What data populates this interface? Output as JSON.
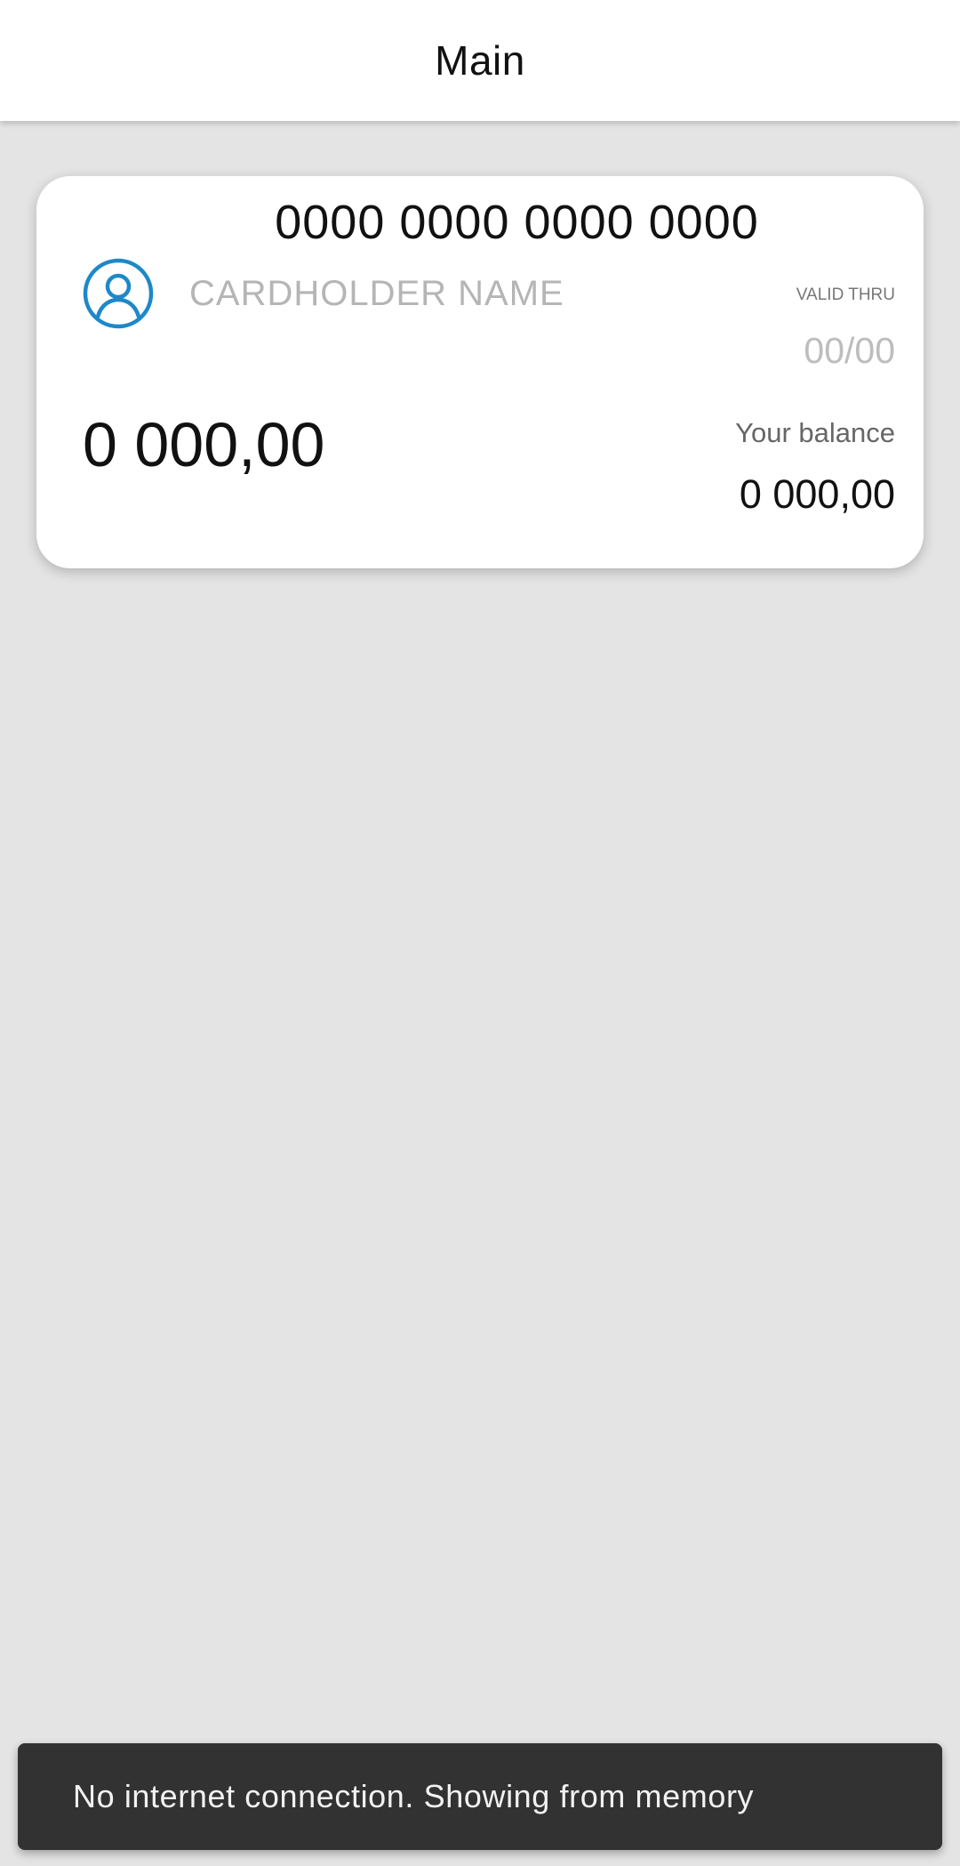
{
  "app_bar": {
    "title": "Main"
  },
  "card": {
    "number": "0000 0000 0000 0000",
    "avatar_icon": "account-circle-icon",
    "cardholder_placeholder": "CARDHOLDER NAME",
    "valid_thru_label": "VALID THRU",
    "valid_thru_value": "00/00",
    "amount": "0 000,00",
    "balance_label": "Your balance",
    "balance_value": "0 000,00"
  },
  "snackbar": {
    "message": "No internet connection. Showing from memory"
  },
  "colors": {
    "accent": "#1e88c8",
    "background": "#e4e4e4",
    "snackbar": "#323232"
  }
}
